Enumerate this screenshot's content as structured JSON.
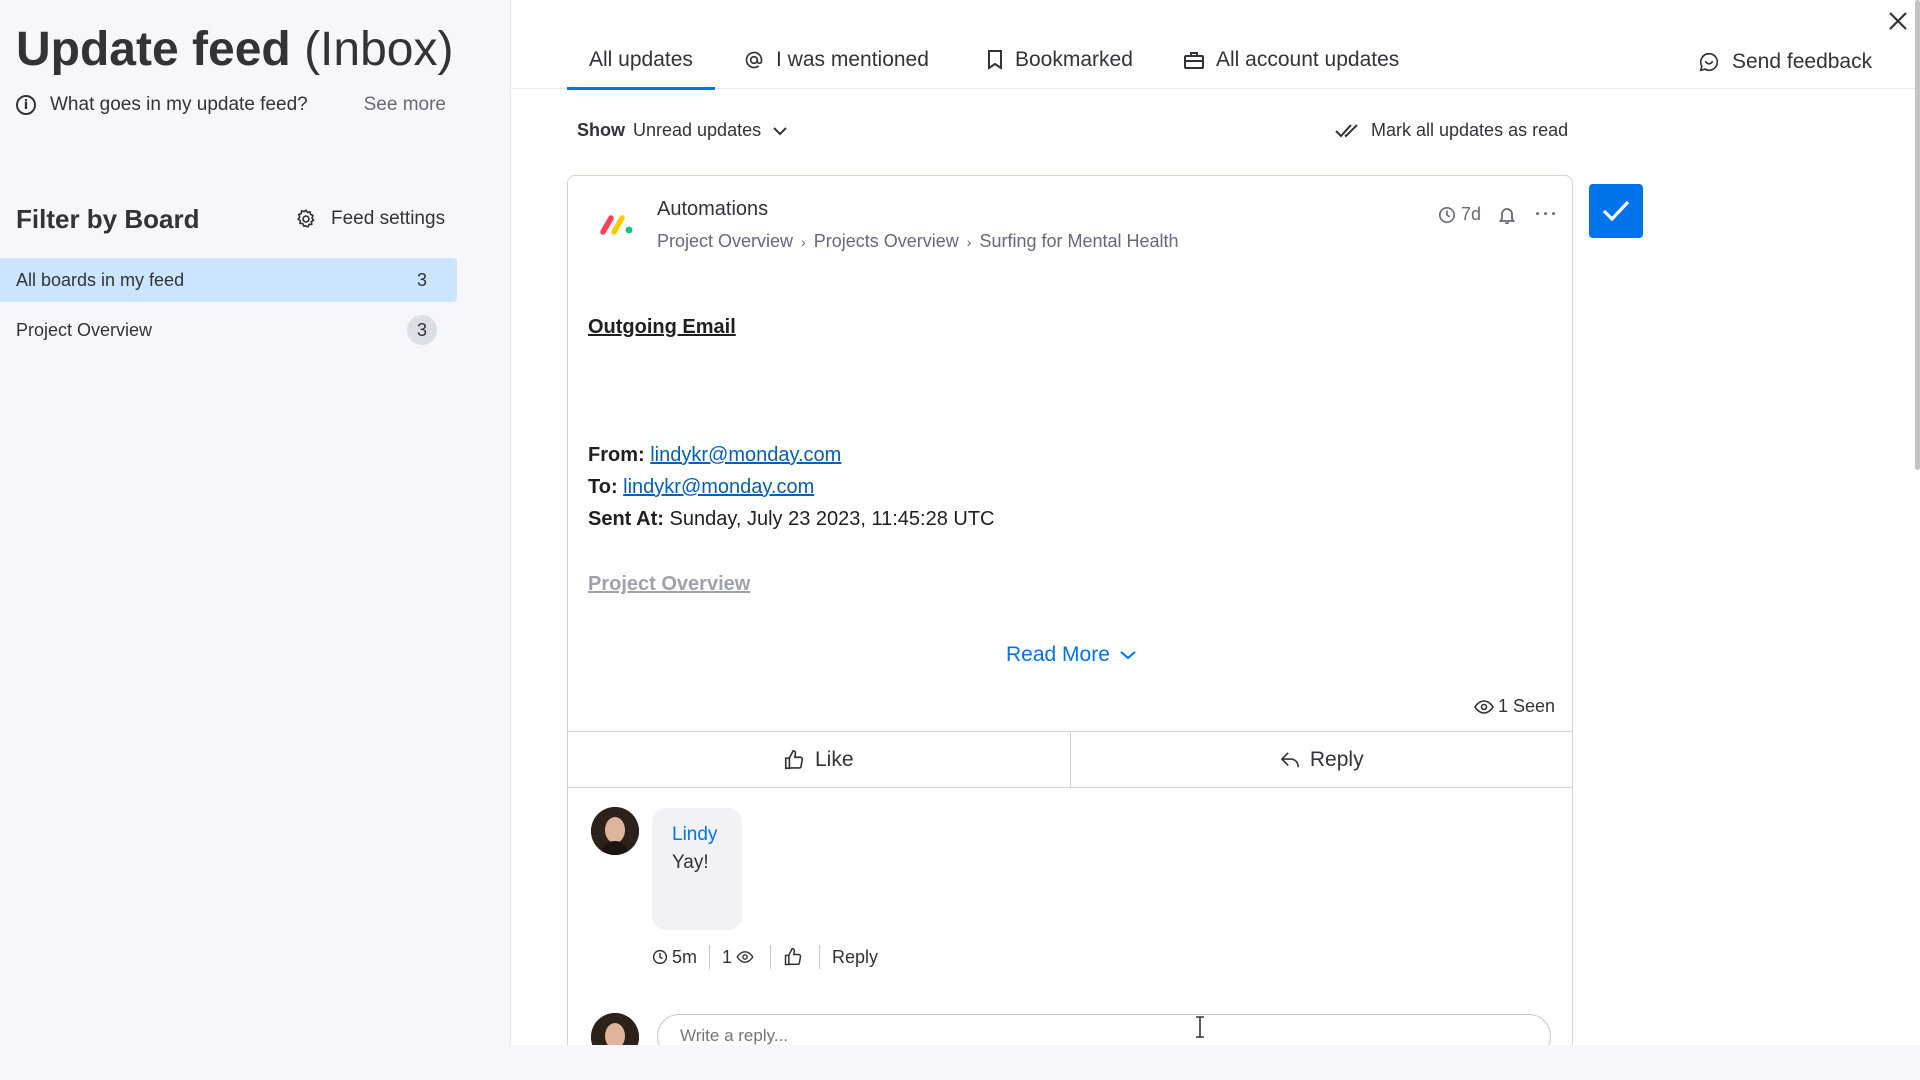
{
  "sidebar": {
    "title_main": "Update feed",
    "title_sub": "(Inbox)",
    "info_text": "What goes in my update feed?",
    "see_more": "See more",
    "filter_title": "Filter by Board",
    "feed_settings": "Feed settings",
    "boards": [
      {
        "label": "All boards in my feed",
        "count": "3",
        "selected": true
      },
      {
        "label": "Project Overview",
        "count": "3",
        "selected": false
      }
    ]
  },
  "tabs": [
    {
      "label": "All updates",
      "icon": "none",
      "active": true
    },
    {
      "label": "I was mentioned",
      "icon": "at-icon"
    },
    {
      "label": "Bookmarked",
      "icon": "bookmark-icon"
    },
    {
      "label": "All account updates",
      "icon": "briefcase-icon"
    }
  ],
  "send_feedback": "Send feedback",
  "filter": {
    "show_label": "Show",
    "show_value": "Unread updates",
    "mark_all_read": "Mark all updates as read"
  },
  "update": {
    "sender": "Automations",
    "breadcrumbs": [
      "Project Overview",
      "Projects Overview",
      "Surfing for Mental Health"
    ],
    "age": "7d",
    "heading": "Outgoing Email",
    "from_label": "From:",
    "from_value": "lindykr@monday.com",
    "to_label": "To:",
    "to_value": "lindykr@monday.com",
    "sent_label": "Sent At:",
    "sent_value": "Sunday, July 23 2023, 11:45:28 UTC",
    "project_link": "Project Overview",
    "read_more": "Read More",
    "seen": "1 Seen",
    "like": "Like",
    "reply": "Reply"
  },
  "reply_item": {
    "author": "Lindy",
    "text": "Yay!",
    "age": "5m",
    "views": "1",
    "reply_label": "Reply"
  },
  "reply_input": {
    "placeholder": "Write a reply..."
  },
  "colors": {
    "accent": "#0073ea",
    "selected_bg": "#cce5ff",
    "sidebar_bg": "#f6f7fb"
  }
}
